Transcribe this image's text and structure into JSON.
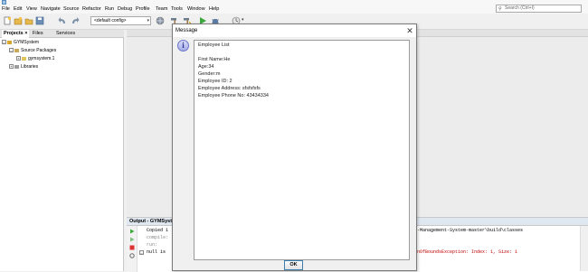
{
  "menu": {
    "items": [
      "File",
      "Edit",
      "View",
      "Navigate",
      "Source",
      "Refactor",
      "Run",
      "Debug",
      "Profile",
      "Team",
      "Tools",
      "Window",
      "Help"
    ]
  },
  "search": {
    "placeholder": "Search (Ctrl+I)"
  },
  "toolbar": {
    "config_value": "<default config>"
  },
  "projects_panel": {
    "tabs": [
      "Projects",
      "Files",
      "Services"
    ],
    "tree": {
      "root": "GYMSystem",
      "source_packages": "Source Packages",
      "package": "gymsystem.1",
      "libraries": "Libraries"
    }
  },
  "output": {
    "title": "Output - GYMSyst",
    "lines": {
      "copied": "Copied 1",
      "compile": "compile:",
      "run": "run:",
      "null_line": "null is",
      "path_tail": "-Management-System-master\\build\\classes",
      "exception_tail": "nOfBoundsException: Index: 1, Size: 1"
    }
  },
  "dialog": {
    "title": "Message",
    "lines": [
      "Employee List",
      "",
      "First Name:He",
      "Age:34",
      "Gender:m",
      "Employee ID: 2",
      "Employee Address: sfsfsfsfs",
      "Employee Phone No: 43434334"
    ],
    "ok_label": "OK"
  },
  "colors": {
    "accent": "#3c7fb1",
    "info_icon": "#2f3a98",
    "error_text": "#c00000"
  }
}
